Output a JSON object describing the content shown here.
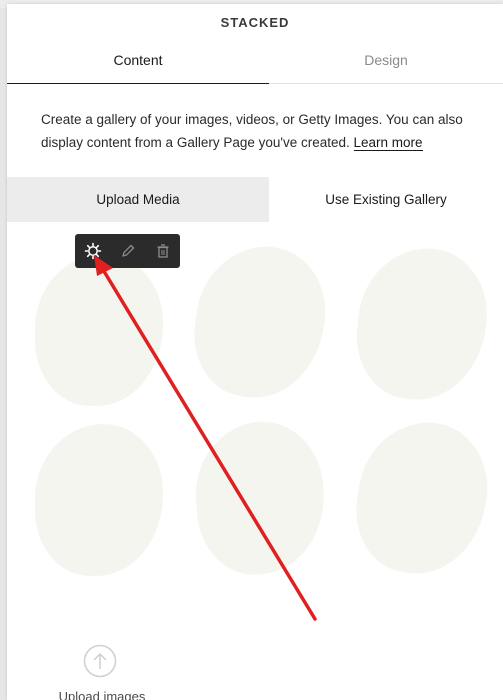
{
  "panel": {
    "title": "STACKED",
    "tabs": [
      {
        "label": "Content",
        "active": true
      },
      {
        "label": "Design",
        "active": false
      }
    ],
    "description": "Create a gallery of your images, videos, or Getty Images. You can also display content from a Gallery Page you've created.",
    "learn_more": "Learn more",
    "source_tabs": [
      {
        "label": "Upload Media",
        "active": true
      },
      {
        "label": "Use Existing Gallery",
        "active": false
      }
    ],
    "toolbar": {
      "icons": [
        "gear-icon",
        "pencil-icon",
        "trash-icon"
      ]
    },
    "upload": {
      "icon": "upload-arrow-icon",
      "label": "Upload images"
    }
  },
  "colors": {
    "annotation_arrow": "#e02020",
    "toolbar_bg": "#2b2b2b",
    "placeholder": "#f5f5f0",
    "active_source_tab": "#ececec"
  }
}
